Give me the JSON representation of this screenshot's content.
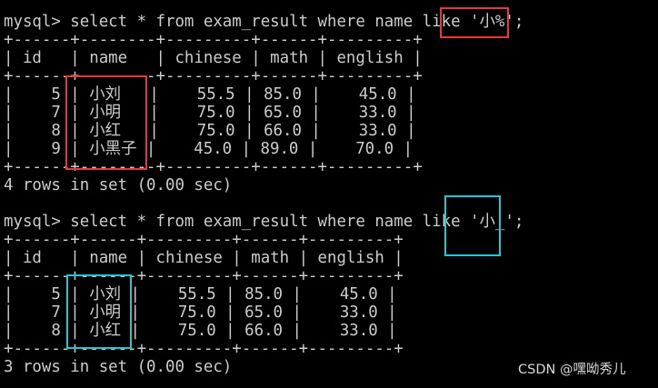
{
  "colors": {
    "background": "#000000",
    "text": "#cccccc",
    "highlight_1": "#e8383d",
    "highlight_2": "#22c7d6"
  },
  "lines": [
    "mysql> select * from exam_result where name like '小%';",
    "+------+--------+---------+------+---------+",
    "| id   | name   | chinese | math | english |",
    "+------+--------+---------+------+---------+",
    "|    5 | 小刘   |    55.5 | 85.0 |    45.0 |",
    "|    7 | 小明   |    75.0 | 65.0 |    33.0 |",
    "|    8 | 小红   |    75.0 | 66.0 |    33.0 |",
    "|    9 | 小黑子 |    45.0 | 89.0 |    70.0 |",
    "+------+--------+---------+------+---------+",
    "4 rows in set (0.00 sec)",
    "",
    "mysql> select * from exam_result where name like '小_';",
    "+------+------+---------+------+---------+",
    "| id   | name | chinese | math | english |",
    "+------+------+---------+------+---------+",
    "|    5 | 小刘 |    55.5 | 85.0 |    45.0 |",
    "|    7 | 小明 |    75.0 | 65.0 |    33.0 |",
    "|    8 | 小红 |    75.0 | 66.0 |    33.0 |",
    "+------+------+---------+------+---------+",
    "3 rows in set (0.00 sec)"
  ],
  "watermark": "CSDN @嘿呦秀儿"
}
